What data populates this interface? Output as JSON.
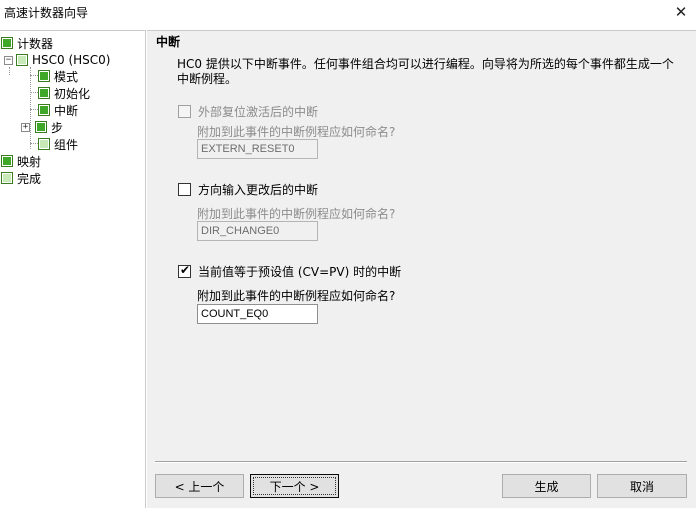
{
  "window": {
    "title": "高速计数器向导"
  },
  "tree": {
    "items": [
      {
        "label": "计数器",
        "state": "checked"
      },
      {
        "label": "HSC0 (HSC0)",
        "state": "empty"
      },
      {
        "label": "模式",
        "state": "checked"
      },
      {
        "label": "初始化",
        "state": "checked"
      },
      {
        "label": "中断",
        "state": "checked"
      },
      {
        "label": "步",
        "state": "checked"
      },
      {
        "label": "组件",
        "state": "empty"
      },
      {
        "label": "映射",
        "state": "checked"
      },
      {
        "label": "完成",
        "state": "empty"
      }
    ]
  },
  "page": {
    "title": "中断",
    "description": "HC0 提供以下中断事件。任何事件组合均可以进行编程。向导将为所选的每个事件都生成一个中断例程。",
    "options": [
      {
        "label": "外部复位激活后的中断",
        "checked": false,
        "enabled": false,
        "prompt": "附加到此事件的中断例程应如何命名?",
        "value": "EXTERN_RESET0"
      },
      {
        "label": "方向输入更改后的中断",
        "checked": false,
        "enabled": true,
        "prompt": "附加到此事件的中断例程应如何命名?",
        "value": "DIR_CHANGE0"
      },
      {
        "label": "当前值等于预设值 (CV=PV) 时的中断",
        "checked": true,
        "enabled": true,
        "prompt": "附加到此事件的中断例程应如何命名?",
        "value": "COUNT_EQ0"
      }
    ]
  },
  "buttons": {
    "prev": "< 上一个",
    "next": "下一个 >",
    "generate": "生成",
    "cancel": "取消"
  },
  "colors": {
    "tree_check_green": "#40a829",
    "panel_bg": "#f0f0f0"
  }
}
